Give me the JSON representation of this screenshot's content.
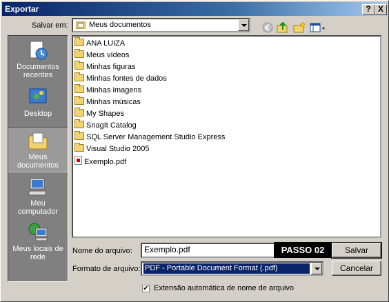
{
  "window": {
    "title": "Exportar",
    "help_label": "?",
    "close_label": "X"
  },
  "save_in": {
    "label": "Salvar em:",
    "value": "Meus documentos"
  },
  "places": [
    {
      "line1": "Documentos",
      "line2": "recentes"
    },
    {
      "line1": "Desktop",
      "line2": ""
    },
    {
      "line1": "Meus",
      "line2": "documentos"
    },
    {
      "line1": "Meu",
      "line2": "computador"
    },
    {
      "line1": "Meus locais de",
      "line2": "rede"
    }
  ],
  "files": [
    {
      "name": "ANA LUIZA",
      "icon": "folder-icon"
    },
    {
      "name": "Meus vídeos",
      "icon": "video-folder-icon"
    },
    {
      "name": "Minhas figuras",
      "icon": "picture-folder-icon"
    },
    {
      "name": "Minhas fontes de dados",
      "icon": "datasource-folder-icon"
    },
    {
      "name": "Minhas imagens",
      "icon": "picture-folder-icon"
    },
    {
      "name": "Minhas músicas",
      "icon": "music-folder-icon"
    },
    {
      "name": "My Shapes",
      "icon": "shapes-folder-icon"
    },
    {
      "name": "SnagIt Catalog",
      "icon": "folder-icon"
    },
    {
      "name": "SQL Server Management Studio Express",
      "icon": "folder-icon"
    },
    {
      "name": "Visual Studio 2005",
      "icon": "folder-icon"
    },
    {
      "name": "Exemplo.pdf",
      "icon": "pdf-file-icon"
    }
  ],
  "filename": {
    "label": "Nome do arquivo:",
    "value": "Exemplo.pdf"
  },
  "format": {
    "label": "Formato de arquivo:",
    "value": "PDF - Portable Document Format (.pdf)"
  },
  "annotation": {
    "text": "PASSO 02"
  },
  "buttons": {
    "save": "Salvar",
    "cancel": "Cancelar"
  },
  "auto_ext": {
    "label": "Extensão automática de nome de arquivo",
    "checked": true,
    "check_mark": "✔"
  }
}
